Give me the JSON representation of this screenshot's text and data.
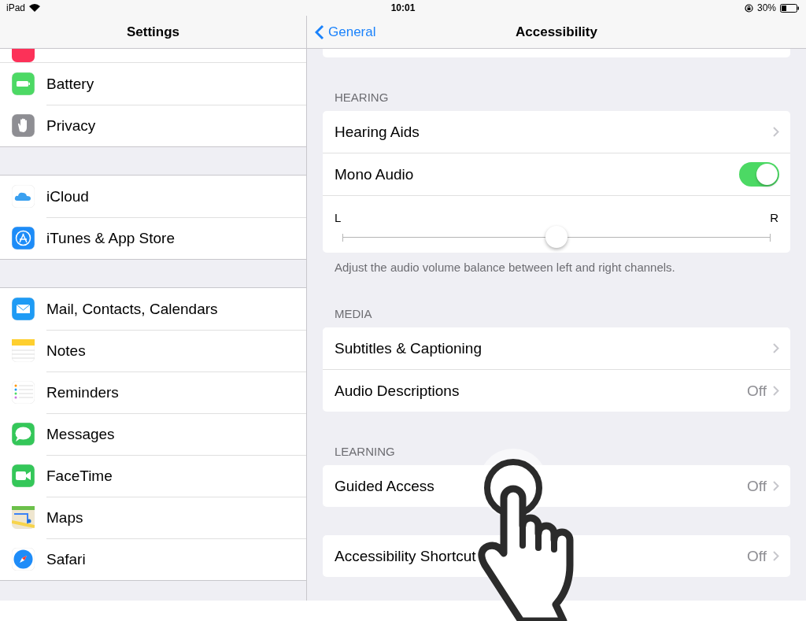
{
  "status_bar": {
    "device": "iPad",
    "time": "10:01",
    "battery": "30%"
  },
  "sidebar": {
    "title": "Settings",
    "groups": [
      [
        {
          "label": "Battery",
          "kind": "battery"
        },
        {
          "label": "Privacy",
          "kind": "privacy"
        }
      ],
      [
        {
          "label": "iCloud",
          "kind": "icloud"
        },
        {
          "label": "iTunes & App Store",
          "kind": "appstore"
        }
      ],
      [
        {
          "label": "Mail, Contacts, Calendars",
          "kind": "mail"
        },
        {
          "label": "Notes",
          "kind": "notes"
        },
        {
          "label": "Reminders",
          "kind": "reminders"
        },
        {
          "label": "Messages",
          "kind": "messages"
        },
        {
          "label": "FaceTime",
          "kind": "facetime"
        },
        {
          "label": "Maps",
          "kind": "maps"
        },
        {
          "label": "Safari",
          "kind": "safari"
        }
      ]
    ]
  },
  "detail": {
    "back": "General",
    "title": "Accessibility",
    "sections": [
      {
        "header": "HEARING",
        "rows": [
          {
            "kind": "disclosure",
            "label": "Hearing Aids"
          },
          {
            "kind": "toggle",
            "label": "Mono Audio",
            "on": true
          },
          {
            "kind": "slider",
            "left": "L",
            "right": "R",
            "level": 0.5
          }
        ],
        "footer": "Adjust the audio volume balance between left and right channels."
      },
      {
        "header": "MEDIA",
        "rows": [
          {
            "kind": "disclosure",
            "label": "Subtitles & Captioning"
          },
          {
            "kind": "disclosure",
            "label": "Audio Descriptions",
            "value": "Off"
          }
        ]
      },
      {
        "header": "LEARNING",
        "rows": [
          {
            "kind": "disclosure",
            "label": "Guided Access",
            "value": "Off"
          }
        ]
      },
      {
        "rows": [
          {
            "kind": "disclosure",
            "label": "Accessibility Shortcut",
            "value": "Off"
          }
        ]
      }
    ]
  }
}
